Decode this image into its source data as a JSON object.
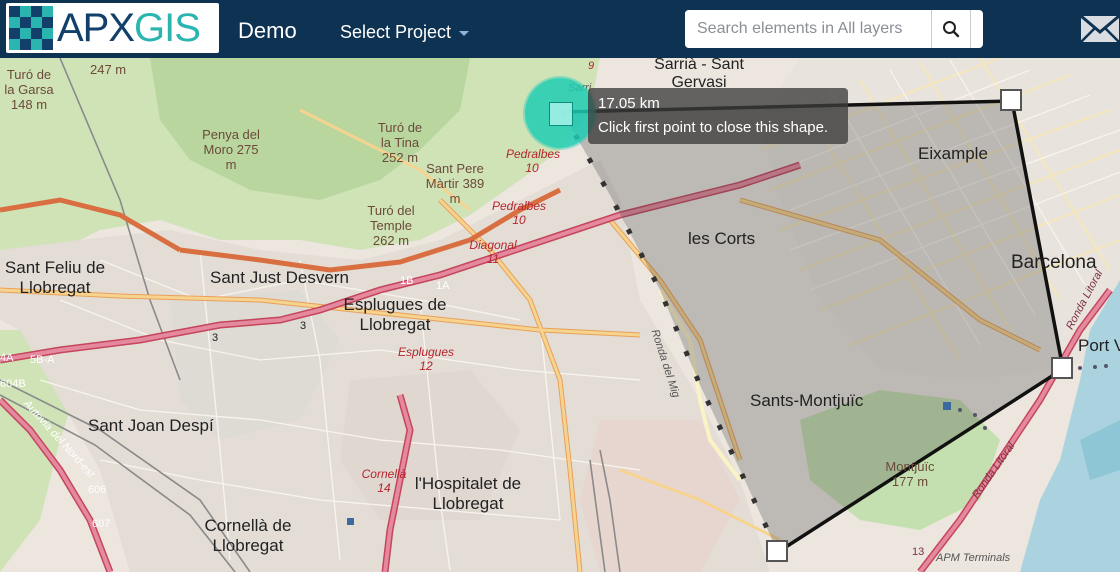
{
  "app": {
    "logo_apx": "APX",
    "logo_gis": "GIS",
    "title": "Demo",
    "project_select_label": "Select Project"
  },
  "search": {
    "placeholder": "Search elements in All layers"
  },
  "tooltip": {
    "distance": "17.05 km",
    "hint": "Click first point to close this shape."
  },
  "map_labels": {
    "cities": [
      "Sant Feliu de Llobregat",
      "Sant Just Desvern",
      "Esplugues de Llobregat",
      "Sant Joan Despí",
      "Cornellà de Llobregat",
      "l'Hospitalet de Llobregat",
      "les Corts",
      "Eixample",
      "Barcelona",
      "Sants-Montjuïc",
      "Sarrià - Sant Gervasi",
      "Port V"
    ],
    "peaks": [
      "Turó de la Garsa 148 m",
      "Penya del Moro 275 m",
      "Turó de la Tina 252 m",
      "Sant Pere Màrtir 389 m",
      "Turó del Temple 262 m",
      "Montjuïc 177 m",
      "247 m"
    ],
    "roads": [
      "Pedralbes 10",
      "Pedralbes 10",
      "Diagonal 11",
      "Esplugues 12",
      "Cornellà 14",
      "Ronda del Mig",
      "Autovia del Nord-est",
      "Ronda Litoral",
      "Ronda Litoral",
      "APM Terminals",
      "9",
      "1B",
      "1A",
      "3",
      "3",
      "5B-A",
      "4A",
      "604B",
      "606",
      "607",
      "13",
      "Sarri"
    ]
  },
  "colors": {
    "navbar": "#0e3251",
    "accent": "#2bb5b0",
    "first_point": "#1fccb4"
  }
}
